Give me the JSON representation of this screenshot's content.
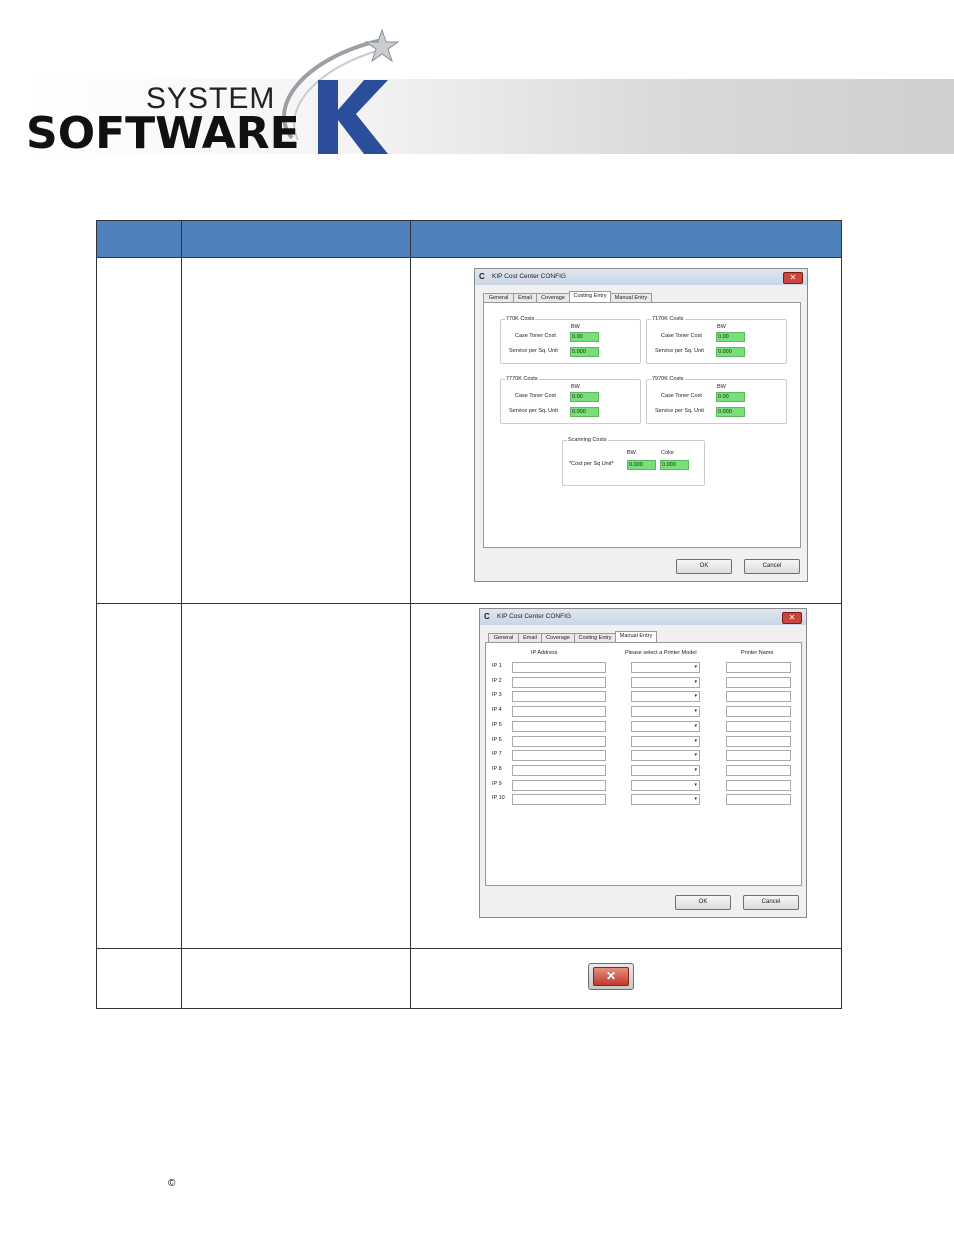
{
  "logo": {
    "line1": "SYSTEM",
    "line2": "SOFTWARE",
    "letter": "K"
  },
  "config": {
    "title": "KIP Cost Center CONFIG",
    "app_icon": "C",
    "tabs": [
      "General",
      "Email",
      "Coverage",
      "Costing Entry",
      "Manual Entry"
    ],
    "ok": "OK",
    "cancel": "Cancel"
  },
  "costing": {
    "groups": [
      {
        "title": "770K Costs",
        "col": "BW",
        "row1": "Case Toner Cost",
        "row2": "Service per Sq. Unit",
        "v1": "0.00",
        "v2": "0.000"
      },
      {
        "title": "7170K Costs",
        "col": "BW",
        "row1": "Case Toner Cost",
        "row2": "Service per Sq. Unit",
        "v1": "0.00",
        "v2": "0.000"
      },
      {
        "title": "7770K Costs",
        "col": "BW",
        "row1": "Case Toner Cost",
        "row2": "Service per Sq. Unit",
        "v1": "0.00",
        "v2": "0.000"
      },
      {
        "title": "7970K Costs",
        "col": "BW",
        "row1": "Case Toner Cost",
        "row2": "Service per Sq. Unit",
        "v1": "0.00",
        "v2": "0.000"
      }
    ],
    "scanning": {
      "title": "Scanning Costs",
      "bw": "BW",
      "color": "Color",
      "label": "*Cost per Sq Unit*",
      "bw_val": "0.000",
      "color_val": "0.000"
    }
  },
  "manual": {
    "col_ip": "IP Address",
    "col_model": "Please select a Printer Model",
    "col_name": "Printer Name",
    "rows": [
      "IP 1",
      "IP 2",
      "IP 3",
      "IP 4",
      "IP 5",
      "IP 6",
      "IP 7",
      "IP 8",
      "IP 9",
      "IP 10"
    ]
  },
  "close_glyph": "✕",
  "copyright": "©",
  "colors": {
    "header_blue": "#4f81bd",
    "green_field": "#78e078",
    "close_red": "#c0392b"
  }
}
